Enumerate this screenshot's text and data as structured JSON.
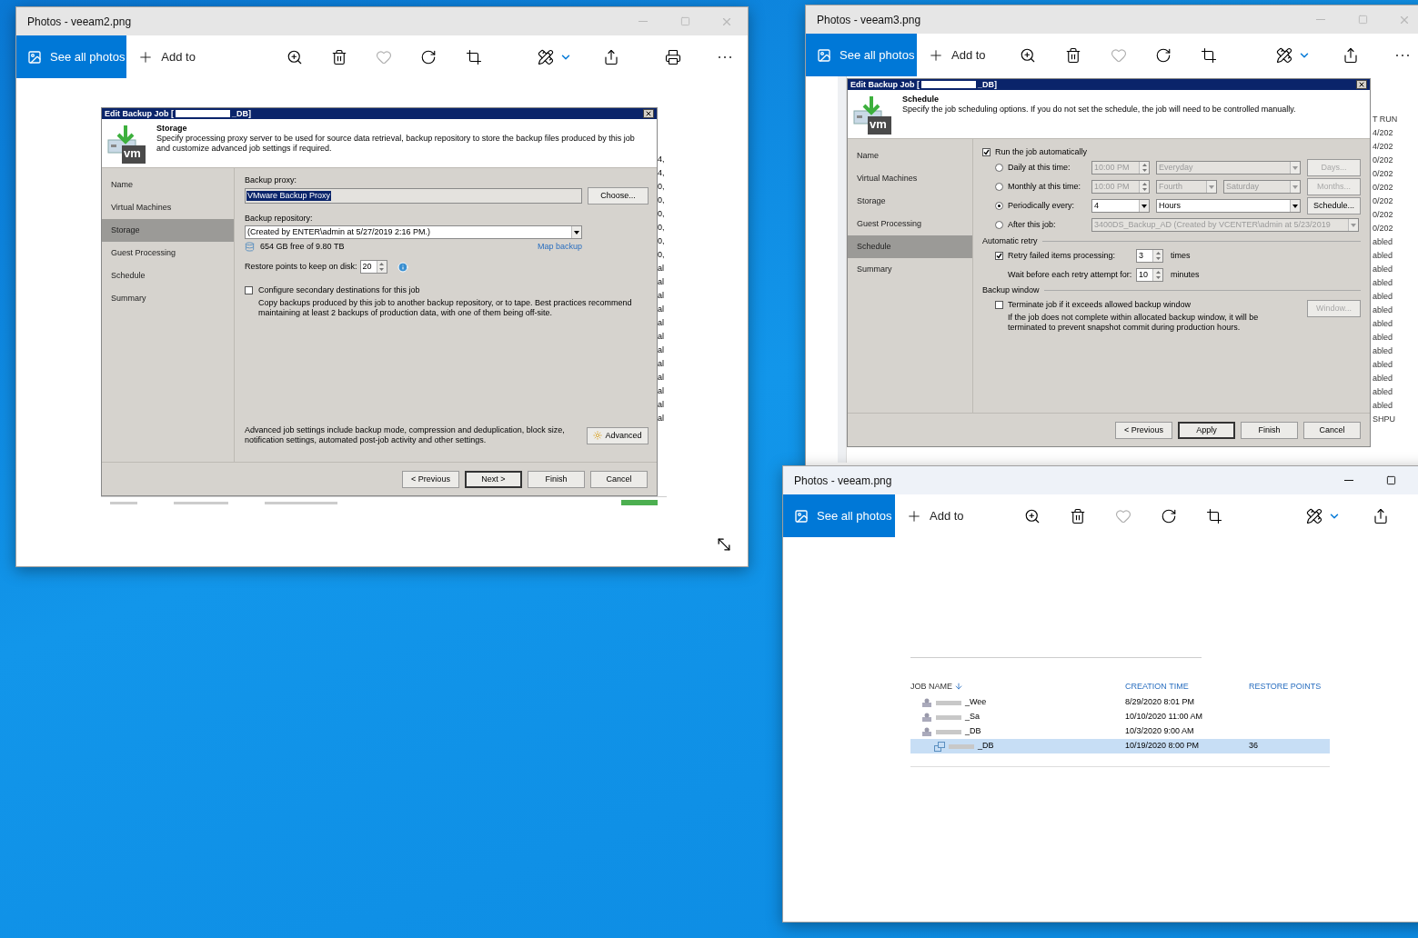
{
  "windows": [
    {
      "title": "Photos - veeam2.png",
      "active": false,
      "title_controls": [
        {
          "kind": "minimize"
        },
        {
          "kind": "maximize"
        },
        {
          "kind": "close"
        }
      ],
      "toolbar": [
        {
          "kind": "primary",
          "label": "See all photos"
        },
        {
          "kind": "add",
          "label": "Add to"
        },
        {
          "kind": "zoom"
        },
        {
          "kind": "delete"
        },
        {
          "kind": "favorite"
        },
        {
          "kind": "rotate"
        },
        {
          "kind": "crop"
        },
        {
          "kind": "edit"
        },
        {
          "kind": "share"
        },
        {
          "kind": "print"
        },
        {
          "kind": "more"
        }
      ],
      "content": {
        "kind": "storage",
        "dialog_title_start": "Edit Backup Job [",
        "dialog_title_end": "_DB]",
        "logo_text": "vm",
        "step_title": "Storage",
        "step_description": "Specify processing proxy server to be used for source data retrieval, backup repository to store the backup files produced by this job and customize advanced job settings if required.",
        "steps": [
          {
            "label": "Name",
            "selected": false
          },
          {
            "label": "Virtual Machines",
            "selected": false
          },
          {
            "label": "Storage",
            "selected": true
          },
          {
            "label": "Guest Processing",
            "selected": false
          },
          {
            "label": "Schedule",
            "selected": false
          },
          {
            "label": "Summary",
            "selected": false
          }
        ],
        "proxy_label": "Backup proxy:",
        "proxy_value": "VMware Backup Proxy",
        "choose_button": "Choose...",
        "repository_label": "Backup repository:",
        "repository_value": "(Created by ENTER\\admin at 5/27/2019 2:16 PM.)",
        "free_space": "654 GB free of 9.80 TB",
        "map_link": "Map backup",
        "restore_label": "Restore points to keep on disk:",
        "restore_value": "20",
        "secondary": {
          "label": "Configure secondary destinations for this job",
          "checked": false,
          "description": "Copy backups produced by this job to another backup repository, or to tape. Best practices recommend maintaining at least 2 backups of production data, with one of them being off-site."
        },
        "advanced_text": "Advanced job settings include backup mode, compression and deduplication, block size, notification settings, automated post-job activity and other settings.",
        "advanced_button": "Advanced",
        "buttons": [
          {
            "label": "< Previous",
            "default": false
          },
          {
            "label": "Next >",
            "default": true
          },
          {
            "label": "Finish",
            "default": false
          },
          {
            "label": "Cancel",
            "default": false
          }
        ],
        "edge_texts": [
          "4,",
          "4,",
          "0,",
          "0,",
          "0,",
          "0,",
          "0,",
          "0,",
          "al",
          "al",
          "al",
          "al",
          "al",
          "al",
          "al",
          "al",
          "al",
          "al",
          "al",
          "al"
        ]
      }
    },
    {
      "title": "Photos - veeam3.png",
      "active": false,
      "title_controls": [
        {
          "kind": "minimize"
        },
        {
          "kind": "maximize"
        },
        {
          "kind": "close"
        }
      ],
      "toolbar": [
        {
          "kind": "primary",
          "label": "See all photos"
        },
        {
          "kind": "add",
          "label": "Add to"
        },
        {
          "kind": "zoom"
        },
        {
          "kind": "delete"
        },
        {
          "kind": "favorite"
        },
        {
          "kind": "rotate"
        },
        {
          "kind": "crop"
        },
        {
          "kind": "edit"
        },
        {
          "kind": "share"
        },
        {
          "kind": "more"
        }
      ],
      "content": {
        "kind": "schedule",
        "dialog_title_start": "Edit Backup Job [",
        "dialog_title_end": "_DB]",
        "logo_text": "vm",
        "step_title": "Schedule",
        "step_description": "Specify the job scheduling options. If you do not set the schedule, the job will need to be controlled manually.",
        "steps": [
          {
            "label": "Name",
            "selected": false
          },
          {
            "label": "Virtual Machines",
            "selected": false
          },
          {
            "label": "Storage",
            "selected": false
          },
          {
            "label": "Guest Processing",
            "selected": false
          },
          {
            "label": "Schedule",
            "selected": true
          },
          {
            "label": "Summary",
            "selected": false
          }
        ],
        "run_auto": {
          "label": "Run the job automatically",
          "checked": true
        },
        "options": [
          {
            "kind": "daily",
            "label": "Daily at this time:",
            "selected": false,
            "time": "10:00 PM",
            "day": "Everyday",
            "button": "Days..."
          },
          {
            "kind": "monthly",
            "label": "Monthly at this time:",
            "selected": false,
            "time": "10:00 PM",
            "week": "Fourth",
            "day": "Saturday",
            "button": "Months..."
          },
          {
            "kind": "periodic",
            "label": "Periodically every:",
            "selected": true,
            "value": "4",
            "unit": "Hours",
            "button": "Schedule..."
          },
          {
            "kind": "after",
            "label": "After this job:",
            "selected": false,
            "job": "3400DS_Backup_AD (Created by VCENTER\\admin at 5/23/2019"
          }
        ],
        "retry_group": "Automatic retry",
        "retry": {
          "label": "Retry failed items processing:",
          "checked": true,
          "value": "3",
          "unit": "times"
        },
        "wait": {
          "label": "Wait before each retry attempt for:",
          "value": "10",
          "unit": "minutes"
        },
        "window_group": "Backup window",
        "terminate": {
          "label": "Terminate job if it exceeds allowed backup window",
          "checked": false,
          "description": "If the job does not complete within allocated backup window, it will be terminated to prevent snapshot commit during production hours.",
          "button": "Window..."
        },
        "buttons": [
          {
            "label": "< Previous",
            "default": false
          },
          {
            "label": "Apply",
            "default": true
          },
          {
            "label": "Finish",
            "default": false
          },
          {
            "label": "Cancel",
            "default": false
          }
        ],
        "edge_texts": [
          "T RUN",
          "4/202",
          "4/202",
          "0/202",
          "0/202",
          "0/202",
          "0/202",
          "0/202",
          "0/202",
          "abled",
          "abled",
          "abled",
          "abled",
          "abled",
          "abled",
          "abled",
          "abled",
          "abled",
          "abled",
          "abled",
          "abled",
          "abled",
          "SHPU"
        ]
      }
    },
    {
      "title": "Photos - veeam.png",
      "active": true,
      "title_controls": [
        {
          "kind": "minimize"
        },
        {
          "kind": "maximize"
        }
      ],
      "toolbar": [
        {
          "kind": "primary",
          "label": "See all photos"
        },
        {
          "kind": "add",
          "label": "Add to"
        },
        {
          "kind": "zoom"
        },
        {
          "kind": "delete"
        },
        {
          "kind": "favorite"
        },
        {
          "kind": "rotate"
        },
        {
          "kind": "crop"
        },
        {
          "kind": "edit"
        },
        {
          "kind": "share"
        }
      ],
      "content": {
        "kind": "joblist",
        "columns": [
          "JOB NAME",
          "CREATION TIME",
          "RESTORE POINTS"
        ],
        "rows": [
          {
            "name": "_Wee",
            "time": "8/29/2020 8:01 PM",
            "selected": false
          },
          {
            "name": "_Sa",
            "time": "10/10/2020 11:00 AM",
            "selected": false
          },
          {
            "name": "_DB",
            "time": "10/3/2020 9:00 AM",
            "selected": false,
            "children": [
              {
                "name": "_DB",
                "time": "10/19/2020 8:00 PM",
                "points": "36",
                "selected": true
              }
            ]
          }
        ]
      }
    }
  ]
}
